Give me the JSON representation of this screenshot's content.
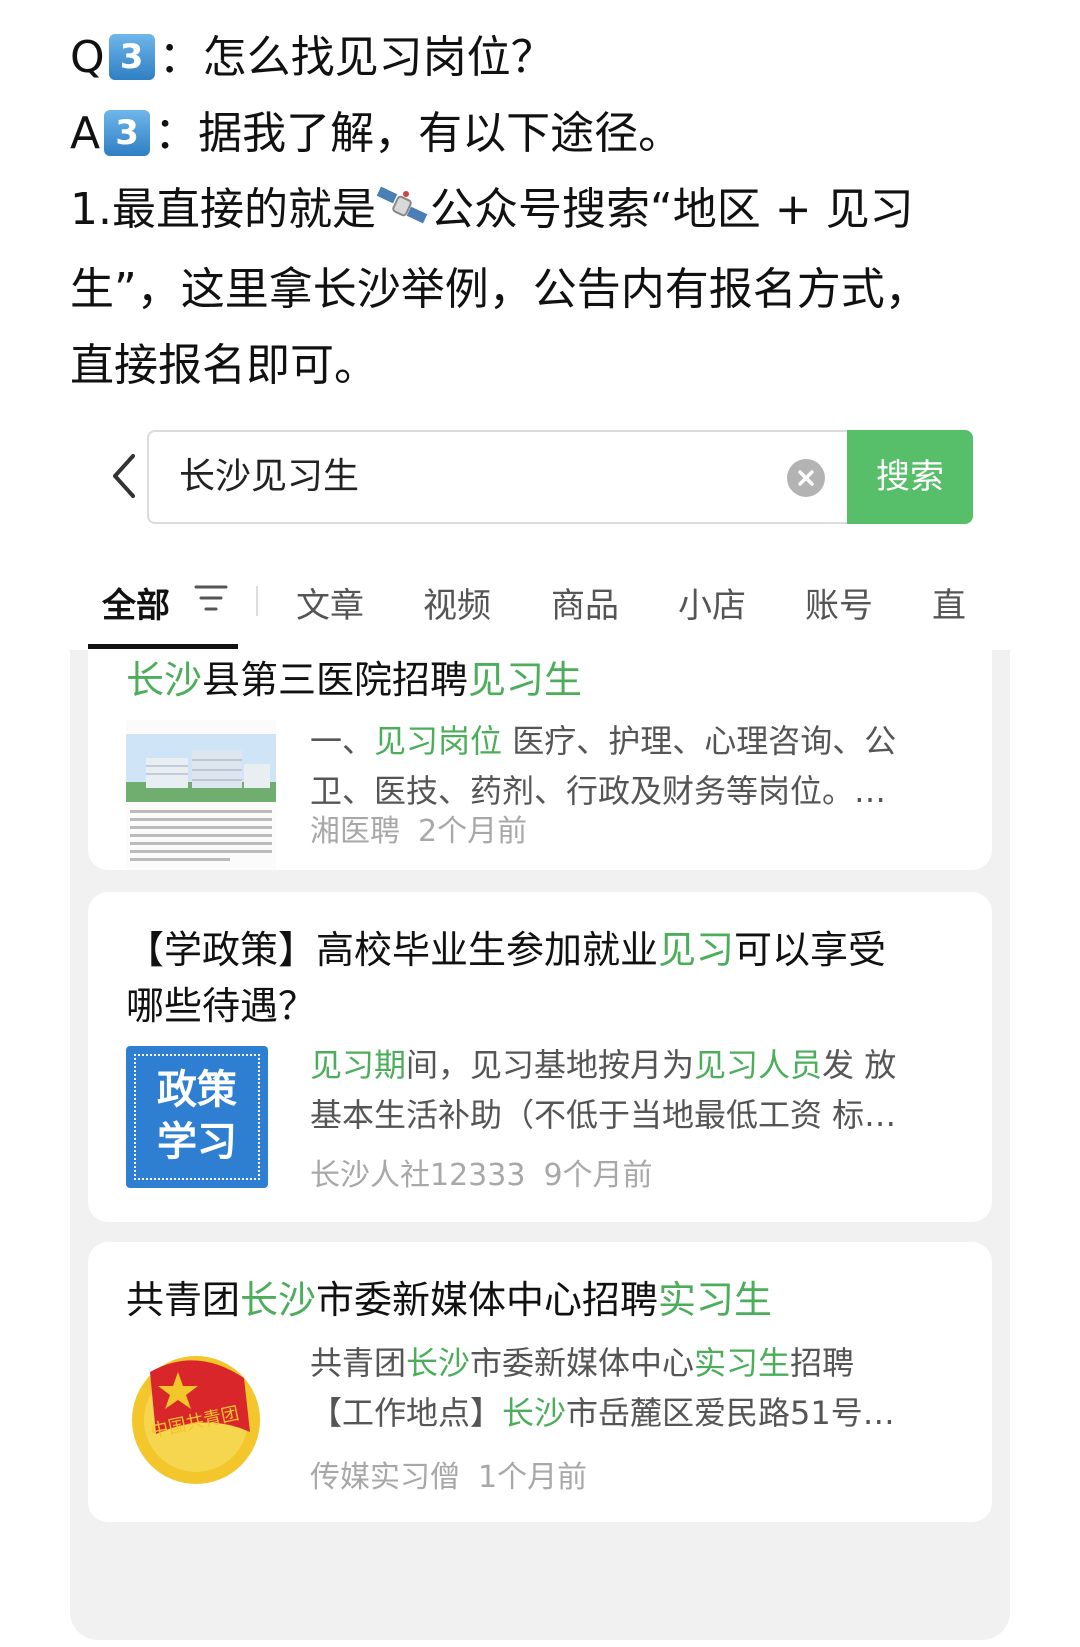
{
  "note": {
    "q_prefix": "Q",
    "q_badge": "3",
    "q_text": "：怎么找见习岗位？",
    "a_prefix": "A",
    "a_badge": "3",
    "a_text": "：据我了解，有以下途径。",
    "line3_pre": " 1.最直接的就是",
    "line3_post": "公众号搜索“地区 + 见习",
    "line4": "生”，这里拿长沙举例，公告内有报名方式，",
    "line5": "直接报名即可。"
  },
  "search": {
    "query": "长沙见习生",
    "button": "搜索"
  },
  "tabs": [
    "全部",
    "文章",
    "视频",
    "商品",
    "小店",
    "账号",
    "直"
  ],
  "results": [
    {
      "title_parts": [
        [
          "长沙",
          "hl"
        ],
        [
          "县第三医院招聘",
          ""
        ],
        [
          "见习生",
          "hl"
        ]
      ],
      "snippet1_parts": [
        [
          "一、",
          ""
        ],
        [
          "见习岗位",
          "hl"
        ],
        [
          " 医疗、护理、心理咨询、公",
          ""
        ]
      ],
      "snippet2": "卫、医技、药剂、行政及财务等岗位。…",
      "source": "湘医聘",
      "time": "2个月前"
    },
    {
      "title_line1_parts": [
        [
          "【学政策】高校毕业生参加就业",
          ""
        ],
        [
          "见习",
          "hl"
        ],
        [
          "可以享受",
          ""
        ]
      ],
      "title_line2": "哪些待遇？",
      "thumb_text": [
        "政策",
        "学习"
      ],
      "snippet1_parts": [
        [
          "见习期",
          "hl"
        ],
        [
          "间，见习基地按月为",
          ""
        ],
        [
          "见习人员",
          "hl"
        ],
        [
          "发 放",
          ""
        ]
      ],
      "snippet2": "基本生活补助（不低于当地最低工资 标…",
      "source": "长沙人社12333",
      "time": "9个月前"
    },
    {
      "title_parts": [
        [
          "共青团",
          ""
        ],
        [
          "长沙",
          "hl"
        ],
        [
          "市委新媒体中心招聘",
          ""
        ],
        [
          "实习生",
          "hl"
        ]
      ],
      "thumb_text": "中国共青团",
      "snippet1_parts": [
        [
          "共青团",
          ""
        ],
        [
          "长沙",
          "hl"
        ],
        [
          "市委新媒体中心",
          ""
        ],
        [
          "实习生",
          "hl"
        ],
        [
          "招聘",
          ""
        ]
      ],
      "snippet2_parts": [
        [
          "【工作地点】",
          ""
        ],
        [
          "长沙",
          "hl"
        ],
        [
          "市岳麓区爱民路51号…",
          ""
        ]
      ],
      "source": "传媒实习僧",
      "time": "1个月前"
    }
  ],
  "colors": {
    "accent": "#57be6a",
    "highlight": "#4cae5b",
    "meta": "#a8a8a8"
  },
  "icons": [
    "satellite-icon",
    "back-chevron-icon",
    "clear-icon",
    "filter-icon"
  ]
}
